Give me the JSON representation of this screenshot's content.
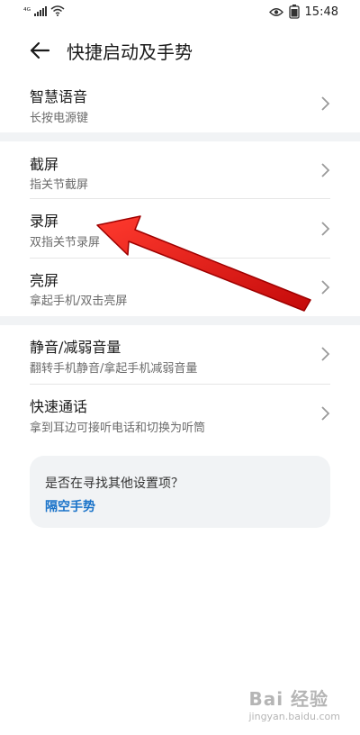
{
  "status_bar": {
    "carrier_tag": "⁴ᴳ",
    "time": "15:48",
    "eye_icon": "eye-comfort-icon",
    "battery_icon": "battery-icon",
    "wifi_icon": "wifi-icon"
  },
  "header": {
    "back_icon": "back-arrow-icon",
    "title": "快捷启动及手势"
  },
  "sections": [
    {
      "items": [
        {
          "title": "智慧语音",
          "subtitle": "长按电源键"
        }
      ]
    },
    {
      "items": [
        {
          "title": "截屏",
          "subtitle": "指关节截屏"
        },
        {
          "title": "录屏",
          "subtitle": "双指关节录屏"
        },
        {
          "title": "亮屏",
          "subtitle": "拿起手机/双击亮屏"
        }
      ]
    },
    {
      "items": [
        {
          "title": "静音/减弱音量",
          "subtitle": "翻转手机静音/拿起手机减弱音量"
        },
        {
          "title": "快速通话",
          "subtitle": "拿到耳边可接听电话和切换为听筒"
        }
      ]
    }
  ],
  "suggestion": {
    "question": "是否在寻找其他设置项？",
    "link": "隔空手势"
  },
  "annotation": {
    "arrow_color": "#e01010",
    "arrow_icon": "red-annotation-arrow"
  },
  "watermark": {
    "main": "Bai 经验",
    "sub": "jingyan.baidu.com"
  },
  "colors": {
    "accent": "#1a73c9",
    "section_bg": "#f1f3f5"
  }
}
